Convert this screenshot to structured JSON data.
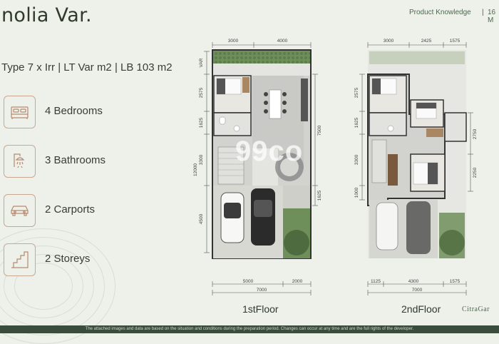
{
  "header": {
    "title": "nolia Var.",
    "product_knowledge": "Product Knowledge",
    "page_marker": "16 M"
  },
  "subtitle": "Type 7 x Irr | LT Var m2 | LB 103 m2",
  "features": [
    {
      "icon": "bed-icon",
      "label": "4 Bedrooms"
    },
    {
      "icon": "shower-icon",
      "label": "3 Bathrooms"
    },
    {
      "icon": "car-icon",
      "label": "2 Carports"
    },
    {
      "icon": "stairs-icon",
      "label": "2 Storeys"
    }
  ],
  "floor1": {
    "label": "1stFloor",
    "top_dims": [
      "3000",
      "4000"
    ],
    "bottom_dims": [
      "5000",
      "2000"
    ],
    "bottom_total": "7000",
    "left_dims": [
      "VAR",
      "2575",
      "1625",
      "3300",
      "12000",
      "4500"
    ],
    "right_dims": [
      "7500",
      "1625"
    ]
  },
  "floor2": {
    "label": "2ndFloor",
    "top_dims": [
      "3000",
      "2425",
      "1575"
    ],
    "bottom_dims": [
      "1125",
      "4300",
      "1575"
    ],
    "bottom_total": "7000",
    "left_dims": [
      "2575",
      "1625",
      "3300",
      "1000"
    ],
    "right_dims": [
      "2750",
      "2250"
    ]
  },
  "watermark": "99co",
  "logo": "CitraGar",
  "footer": "The attached images and data are based on the situation and conditions during the preparation period. Changes can occur at any time and are the full rights of the developer.",
  "colors": {
    "background": "#eef0ea",
    "accent_text": "#4b6a4e",
    "icon_border": "#c9a891",
    "footer_bg": "#3a4c3c"
  }
}
